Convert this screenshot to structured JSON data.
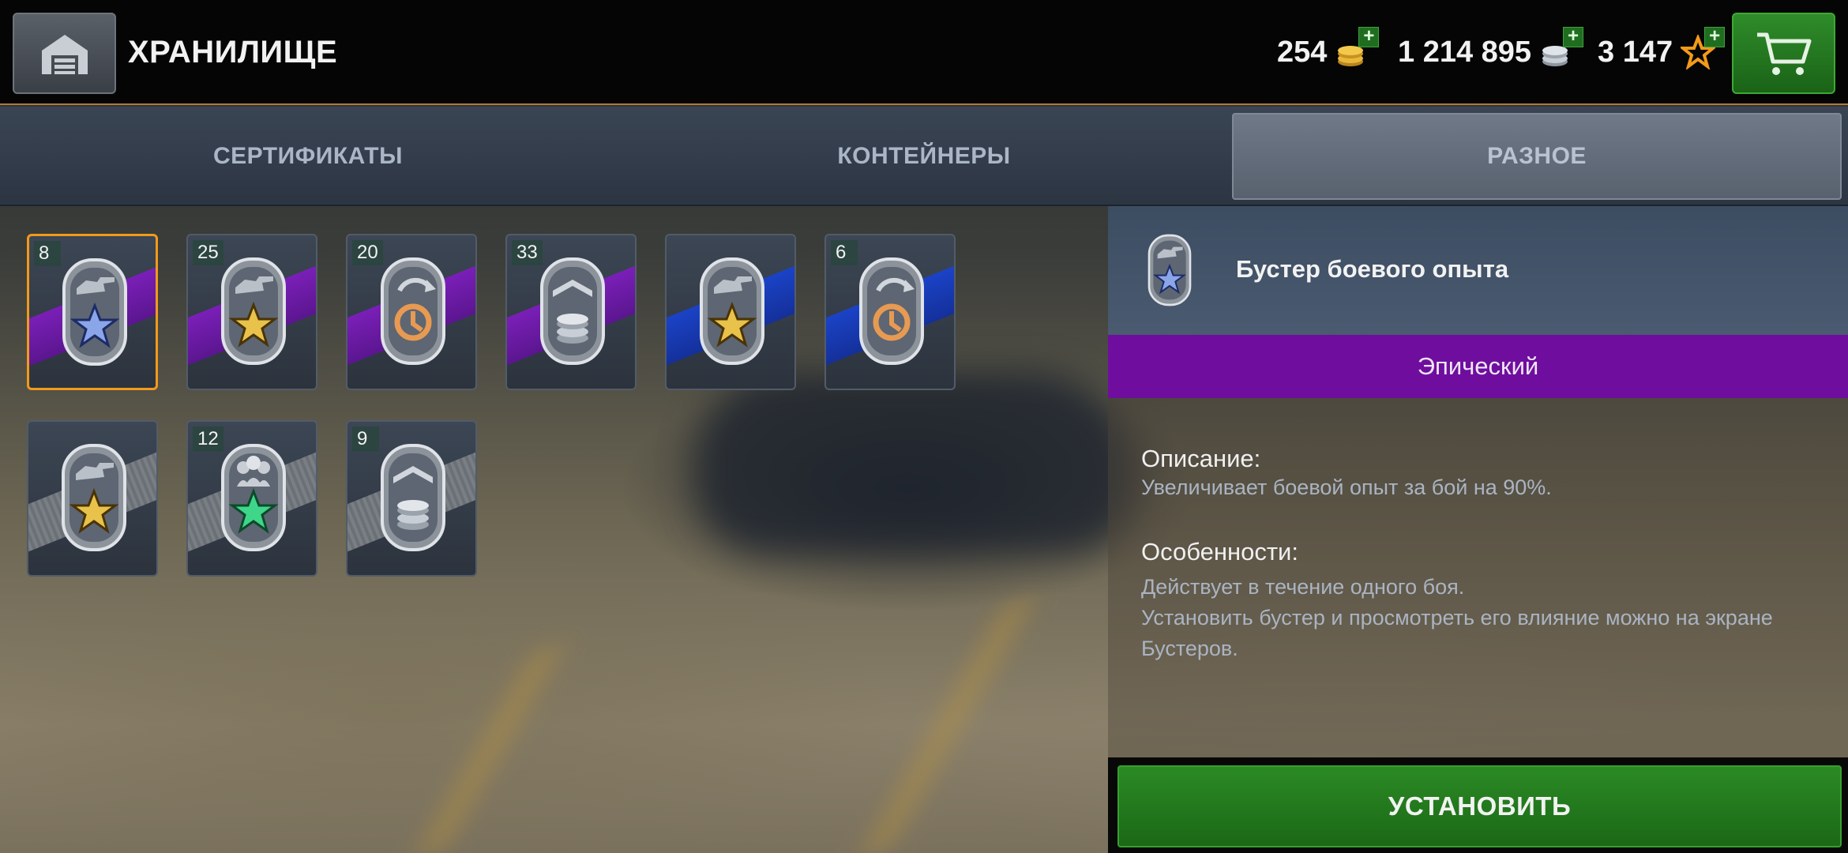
{
  "header": {
    "title": "ХРАНИЛИЩЕ",
    "gold": "254",
    "silver": "1 214 895",
    "free_xp": "3 147",
    "plus_symbol": "+"
  },
  "tabs": [
    {
      "label": "СЕРТИФИКАТЫ",
      "active": false
    },
    {
      "label": "КОНТЕЙНЕРЫ",
      "active": false
    },
    {
      "label": "РАЗНОЕ",
      "active": true
    }
  ],
  "items": [
    {
      "count": "8",
      "rarity": "epic",
      "icon": "combat-xp-booster-icon",
      "selected": true
    },
    {
      "count": "25",
      "rarity": "epic",
      "icon": "vehicle-xp-booster-icon",
      "selected": false
    },
    {
      "count": "20",
      "rarity": "epic",
      "icon": "free-xp-booster-icon",
      "selected": false
    },
    {
      "count": "33",
      "rarity": "epic",
      "icon": "credits-booster-icon",
      "selected": false
    },
    {
      "count": "",
      "rarity": "rare",
      "icon": "vehicle-xp-booster-icon",
      "selected": false
    },
    {
      "count": "6",
      "rarity": "rare",
      "icon": "free-xp-booster-icon",
      "selected": false
    },
    {
      "count": "",
      "rarity": "common",
      "icon": "vehicle-xp-booster-icon",
      "selected": false
    },
    {
      "count": "12",
      "rarity": "common",
      "icon": "crew-xp-booster-icon",
      "selected": false
    },
    {
      "count": "9",
      "rarity": "common",
      "icon": "credits-booster-icon",
      "selected": false
    }
  ],
  "detail": {
    "name": "Бустер боевого опыта",
    "rarity": "Эпический",
    "description_title": "Описание:",
    "description": "Увеличивает боевой опыт за бой на 90%.",
    "features_title": "Особенности:",
    "features_line1": "Действует в течение одного боя.",
    "features_line2": "Установить бустер и просмотреть его влияние можно на экране Бустеров.",
    "install_label": "УСТАНОВИТЬ"
  },
  "colors": {
    "epic": "#6f0e9e",
    "rare": "#1b43c7",
    "selected_border": "#f29a1a",
    "install_green": "#2b8a24"
  }
}
